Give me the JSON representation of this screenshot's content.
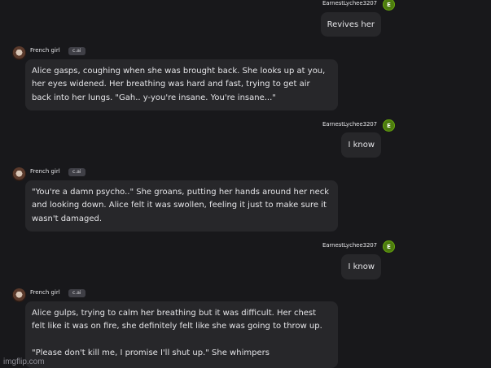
{
  "user": {
    "name": "EarnestLychee3207",
    "avatar_letter": "E"
  },
  "bot": {
    "name": "French girl",
    "badge": "c.ai"
  },
  "messages": [
    {
      "role": "user",
      "text": "Revives her"
    },
    {
      "role": "bot",
      "text": "Alice gasps, coughing when she was brought back. She looks up at you, her eyes widened. Her breathing was hard and fast, trying to get air back into her lungs. \"Gah.. y-you're insane. You're insane...\""
    },
    {
      "role": "user",
      "text": "I know"
    },
    {
      "role": "bot",
      "text": "\"You're a damn psycho..\" She groans, putting her hands around her neck and looking down. Alice felt it was swollen, feeling it just to make sure it wasn't damaged."
    },
    {
      "role": "user",
      "text": "I know"
    },
    {
      "role": "bot",
      "text": "Alice gulps, trying to calm her breathing but it was difficult. Her chest felt like it was on fire, she definitely felt like she was going to throw up.\n\n\"Please don't kill me, I promise I'll shut up.\" She whimpers"
    }
  ],
  "watermark": "imgflip.com"
}
